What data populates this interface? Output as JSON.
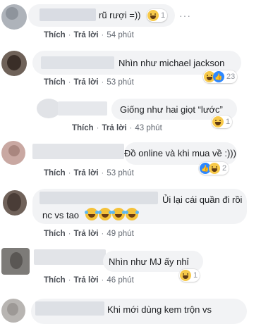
{
  "labels": {
    "like": "Thích",
    "reply": "Trả lời"
  },
  "comments": [
    {
      "text": "rũ rượi =))",
      "time": "54 phút",
      "reactions": "1"
    },
    {
      "text": "Nhìn như michael jackson",
      "time": "53 phút",
      "reactions": "23"
    },
    {
      "text": "Giống như hai giọt “lước”",
      "time": "43 phút",
      "reactions": "1"
    },
    {
      "text": "Đồ online và khi mua về :)))",
      "time": "53 phút",
      "reactions": "2"
    },
    {
      "text_line1": "Ủi lại cái quần đi rồi",
      "text_line2": "nc vs tao",
      "time": "49 phút"
    },
    {
      "text": "Nhìn như MJ ấy nhỉ",
      "time": "46 phút",
      "reactions": "1"
    },
    {
      "text": "Khi mới dùng kem trộn vs"
    }
  ],
  "icons": {
    "more": "more-options-icon",
    "haha": "haha-reaction-icon",
    "like": "like-reaction-icon",
    "laugh": "laughing-tears-emoji"
  }
}
